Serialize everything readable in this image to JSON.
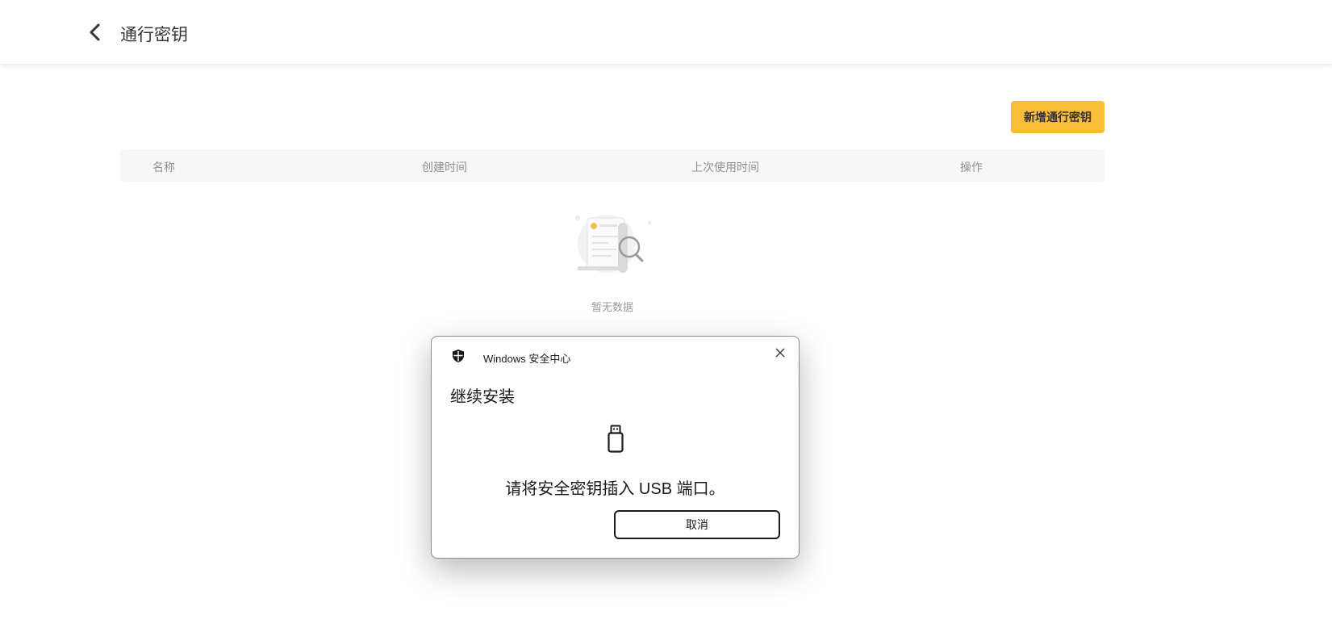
{
  "header": {
    "title": "通行密钥",
    "back_icon": "chevron-left-icon"
  },
  "toolbar": {
    "add_label": "新增通行密钥",
    "add_color": "#fbbd39"
  },
  "table": {
    "columns": [
      "名称",
      "创建时间",
      "上次使用时间",
      "操作"
    ]
  },
  "empty": {
    "text": "暂无数据",
    "icon": "empty-document-search-icon"
  },
  "dialog": {
    "app_name": "Windows 安全中心",
    "title": "继续安装",
    "message": "请将安全密钥插入 USB 端口。",
    "cancel_label": "取消",
    "icons": {
      "app": "shield-icon",
      "close": "close-icon",
      "device": "usb-key-icon"
    }
  }
}
